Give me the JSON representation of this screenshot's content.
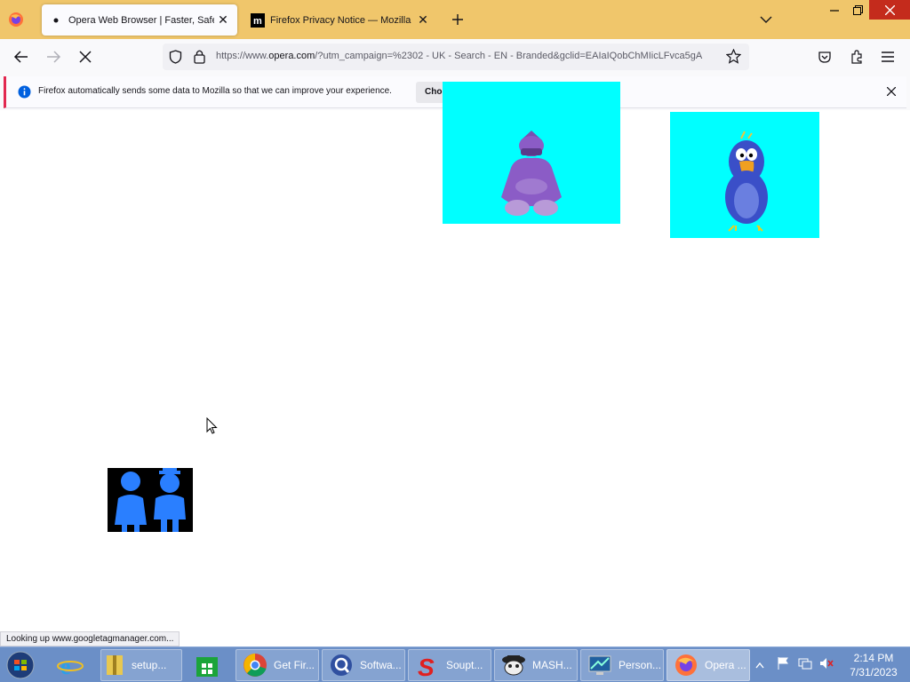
{
  "browser": {
    "tabs": [
      {
        "title": "Opera Web Browser | Faster, Safer, S",
        "active": true
      },
      {
        "title": "Firefox Privacy Notice — Mozilla",
        "active": false
      }
    ],
    "url_prefix": "https://www.",
    "url_domain": "opera.com",
    "url_rest": "/?utm_campaign=%2302 - UK - Search - EN - Branded&gclid=EAIaIQobChMIicLFvca5gA",
    "accent": "#f0c66b"
  },
  "notification": {
    "text": "Firefox automatically sends some data to Mozilla so that we can improve your experience.",
    "button_label": "Choo"
  },
  "status_text": "Looking up www.googletagmanager.com...",
  "taskbar": {
    "items": [
      {
        "label": "setup..."
      },
      {
        "label": "Get Fir..."
      },
      {
        "label": "Softwa..."
      },
      {
        "label": "Soupt..."
      },
      {
        "label": "MASH..."
      },
      {
        "label": "Person..."
      },
      {
        "label": "Opera ..."
      }
    ],
    "time": "2:14 PM",
    "date": "7/31/2023"
  }
}
